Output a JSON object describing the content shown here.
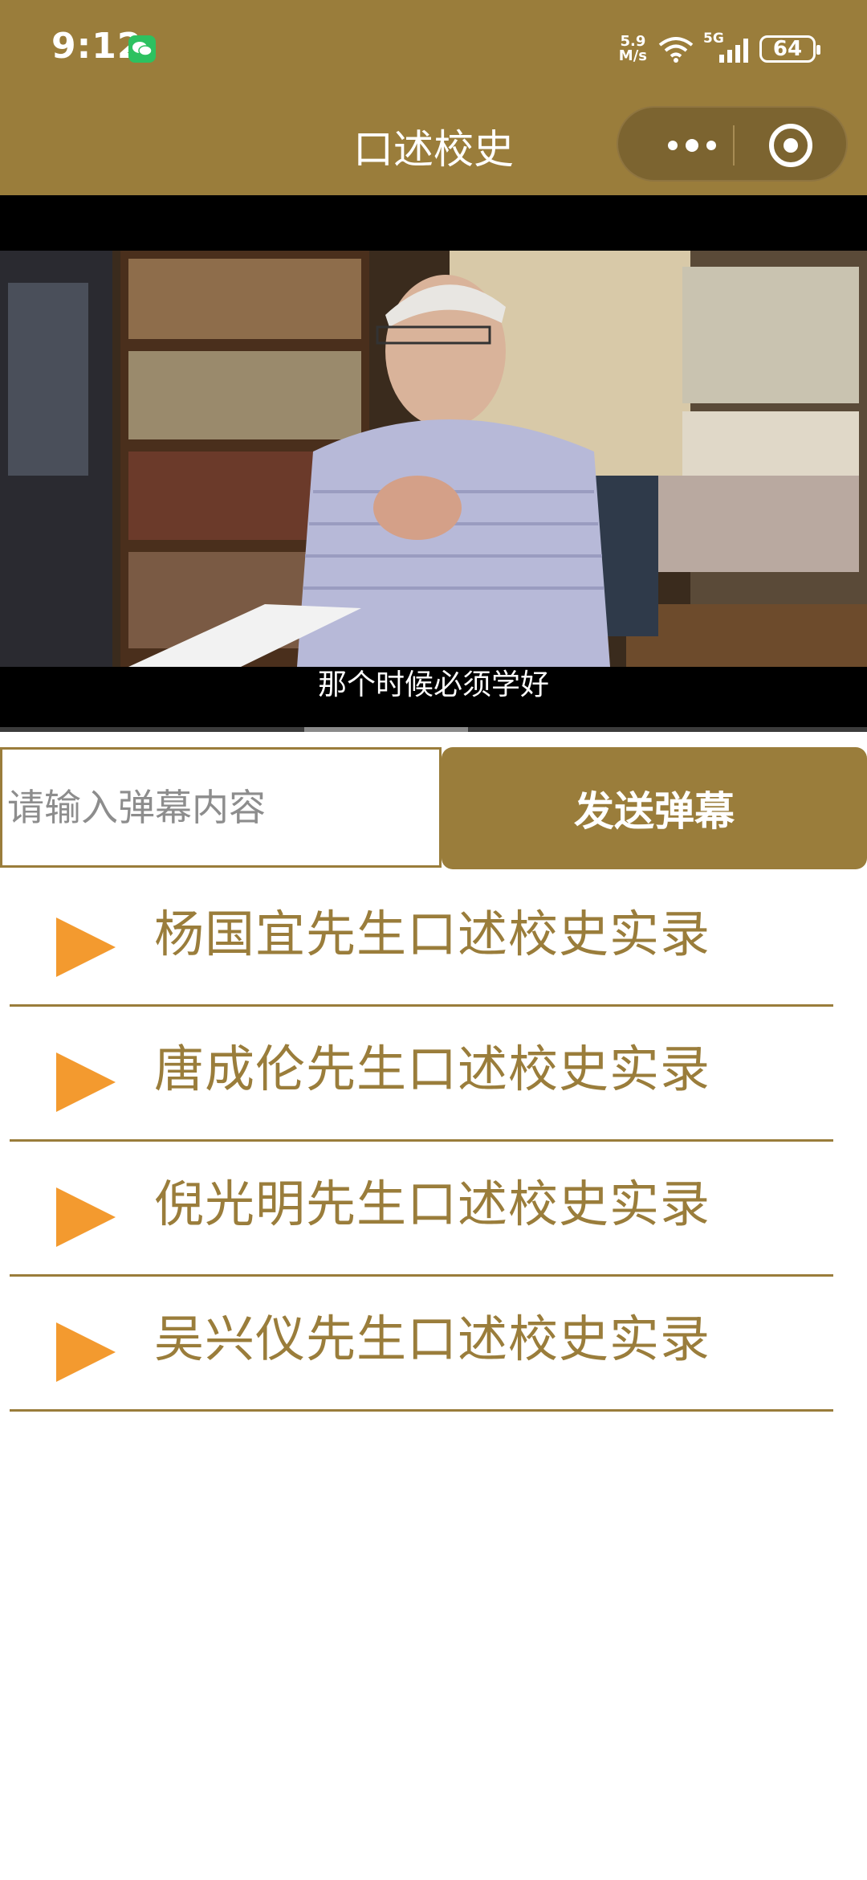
{
  "status_bar": {
    "time": "9:12",
    "net_speed_value": "5.9",
    "net_speed_unit": "M/s",
    "signal_label": "5G",
    "battery": "64"
  },
  "nav": {
    "title": "口述校史"
  },
  "video": {
    "subtitle": "那个时候必须学好",
    "progress_fraction": 0.54
  },
  "danmaku": {
    "placeholder": "请输入弹幕内容",
    "send_label": "发送弹幕"
  },
  "list": {
    "items": [
      {
        "label": "杨国宜先生口述校史实录"
      },
      {
        "label": "唐成伦先生口述校史实录"
      },
      {
        "label": "倪光明先生口述校史实录"
      },
      {
        "label": "吴兴仪先生口述校史实录"
      }
    ]
  },
  "colors": {
    "brand": "#9a7d3b",
    "play_icon": "#f29524"
  }
}
